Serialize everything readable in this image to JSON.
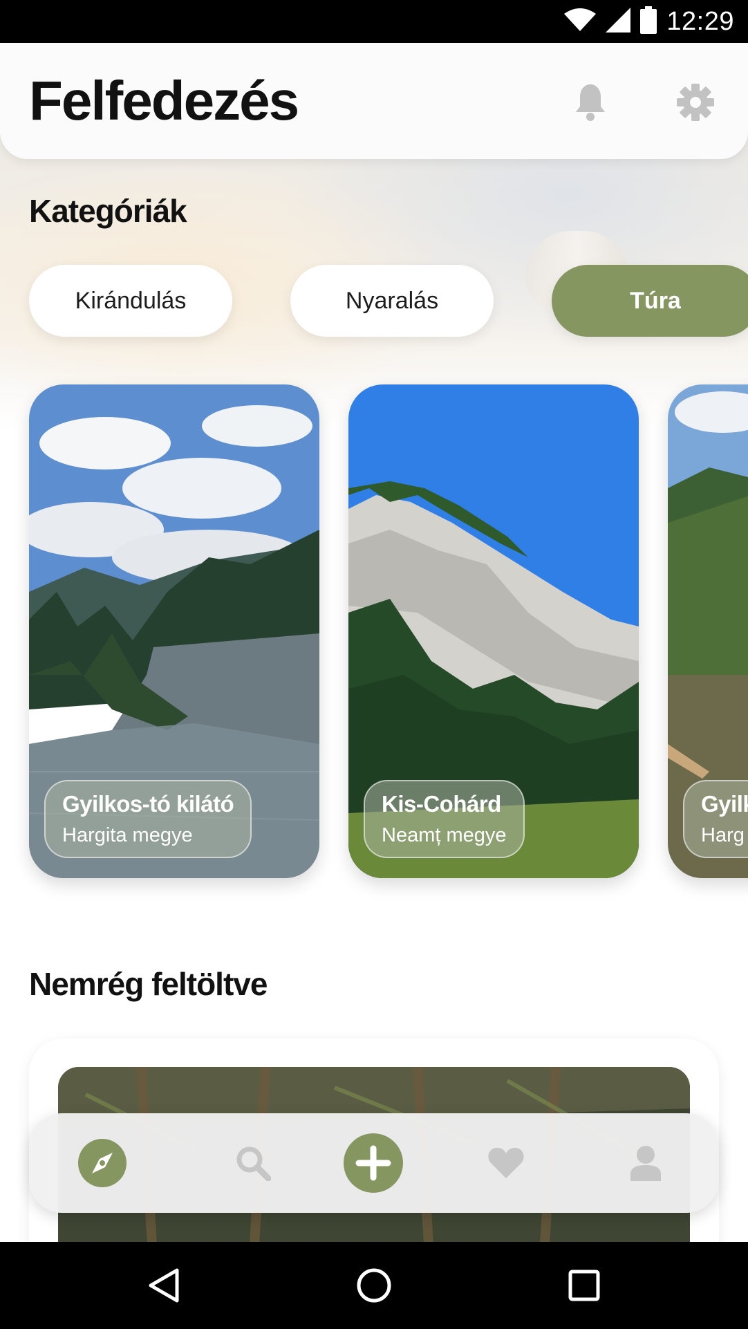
{
  "status_bar": {
    "time": "12:29"
  },
  "header": {
    "title": "Felfedezés"
  },
  "categories": {
    "title": "Kategóriák",
    "chips": [
      {
        "label": "Kirándulás",
        "selected": false
      },
      {
        "label": "Nyaralás",
        "selected": false
      },
      {
        "label": "Túra",
        "selected": true
      }
    ]
  },
  "places": [
    {
      "name": "Gyilkos-tó kilátó",
      "region": "Hargita megye"
    },
    {
      "name": "Kis-Cohárd",
      "region": "Neamț megye"
    },
    {
      "name": "Gyilk",
      "region": "Harg"
    }
  ],
  "recent": {
    "title": "Nemrég feltöltve"
  },
  "bottom_nav": {
    "items": [
      "compass-icon",
      "search-icon",
      "add-icon",
      "heart-icon",
      "profile-icon"
    ],
    "active": "compass-icon"
  },
  "colors": {
    "accent": "#869661",
    "icon_inactive": "#c6c6c6"
  }
}
